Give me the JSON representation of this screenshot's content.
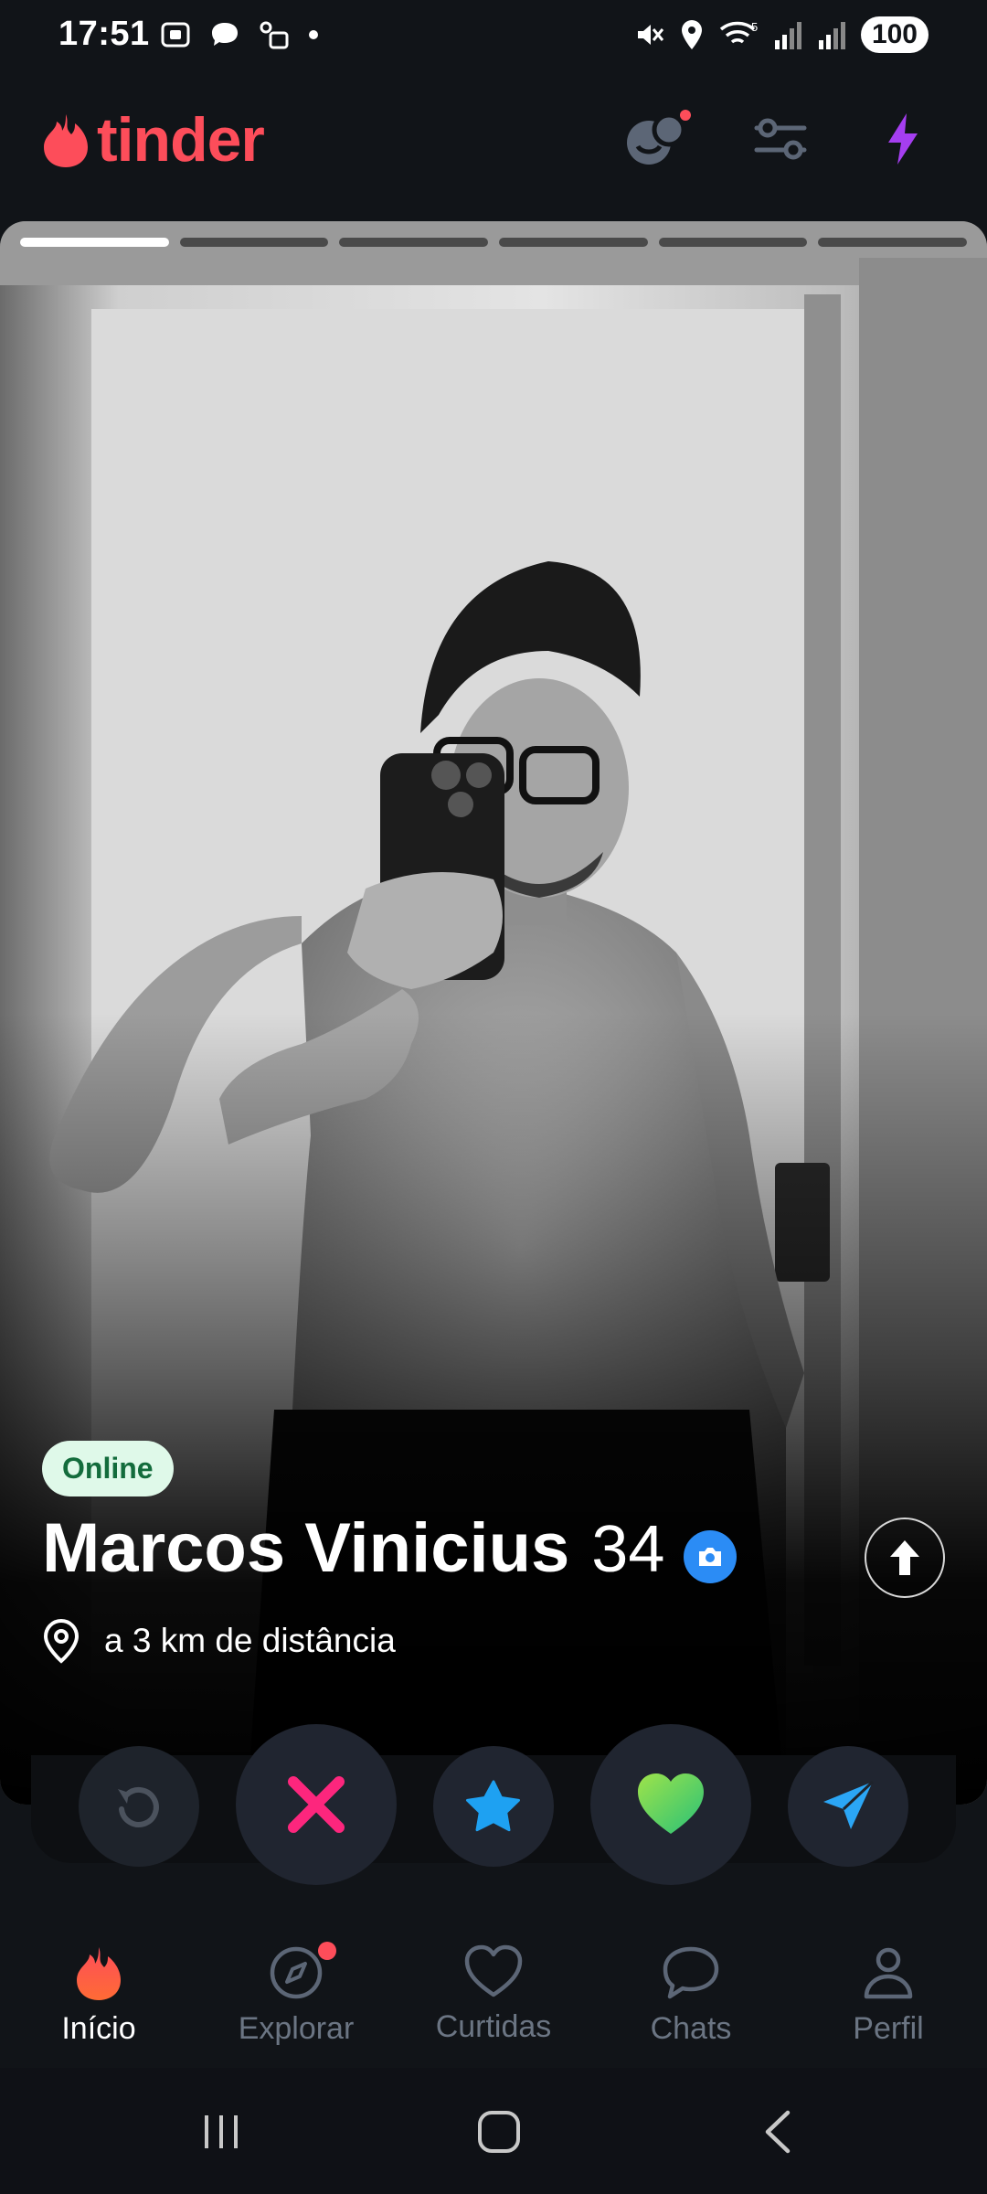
{
  "status_bar": {
    "time": "17:51",
    "battery": "100",
    "network_label": "5"
  },
  "header": {
    "logo_text": "tinder",
    "brand_color": "#fd4d5a"
  },
  "profile": {
    "photo_count": 6,
    "active_photo": 1,
    "online_badge": "Online",
    "name": "Marcos Vinicius",
    "age": "34",
    "distance": "a 3 km de distância"
  },
  "actions": {
    "rewind": "rewind-icon",
    "nope": "x-icon",
    "super_like": "star-icon",
    "like": "heart-icon",
    "boost": "send-icon"
  },
  "nav": {
    "items": [
      {
        "label": "Início",
        "icon": "flame-icon"
      },
      {
        "label": "Explorar",
        "icon": "compass-icon"
      },
      {
        "label": "Curtidas",
        "icon": "heart-outline-icon"
      },
      {
        "label": "Chats",
        "icon": "chat-bubble-icon"
      },
      {
        "label": "Perfil",
        "icon": "person-icon"
      }
    ]
  },
  "colors": {
    "background": "#111418",
    "online_bg": "#dff9e9",
    "online_text": "#136c3c",
    "verified_blue": "#2b8cf5",
    "nope_pink": "#fd267d",
    "star_blue": "#1ea1f2",
    "like_green": "#5fd36a",
    "boost_blue": "#2ba6f5"
  }
}
